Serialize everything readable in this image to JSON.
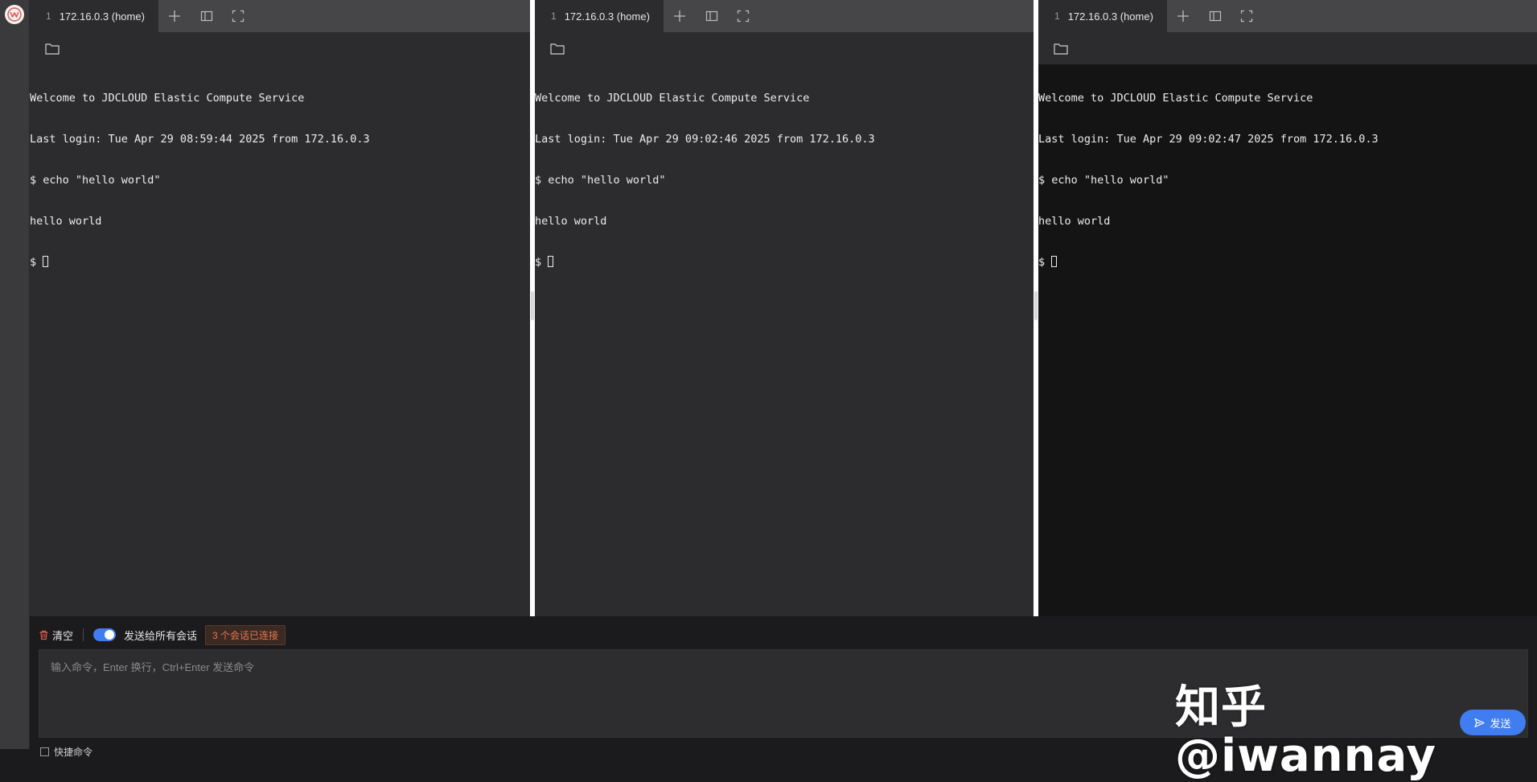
{
  "app": {
    "logo_icon": "app-logo-icon"
  },
  "colors": {
    "accent": "#3f7df0",
    "badge_text": "#e9774c",
    "clear_icon": "#e25a4f"
  },
  "panes": [
    {
      "tab": {
        "index": "1",
        "title": "172.16.0.3 (home)"
      },
      "background": "#2c2c2e",
      "lines": [
        "Welcome to JDCLOUD Elastic Compute Service",
        "Last login: Tue Apr 29 08:59:44 2025 from 172.16.0.3",
        "$ echo \"hello world\"",
        "hello world"
      ],
      "prompt": "$ "
    },
    {
      "tab": {
        "index": "1",
        "title": "172.16.0.3 (home)"
      },
      "background": "#2c2c2e",
      "lines": [
        "Welcome to JDCLOUD Elastic Compute Service",
        "Last login: Tue Apr 29 09:02:46 2025 from 172.16.0.3",
        "$ echo \"hello world\"",
        "hello world"
      ],
      "prompt": "$ "
    },
    {
      "tab": {
        "index": "1",
        "title": "172.16.0.3 (home)"
      },
      "background": "#141414",
      "lines": [
        "Welcome to JDCLOUD Elastic Compute Service",
        "Last login: Tue Apr 29 09:02:47 2025 from 172.16.0.3",
        "$ echo \"hello world\"",
        "hello world"
      ],
      "prompt": "$ "
    }
  ],
  "bottom": {
    "clear_label": "清空",
    "broadcast_label": "发送给所有会话",
    "broadcast_on": true,
    "connected_badge": "3 个会话已连接",
    "input_placeholder": "输入命令，Enter 换行，Ctrl+Enter 发送命令",
    "send_label": "发送",
    "extra_label": "快捷命令"
  },
  "watermark": "知乎 @iwannay"
}
